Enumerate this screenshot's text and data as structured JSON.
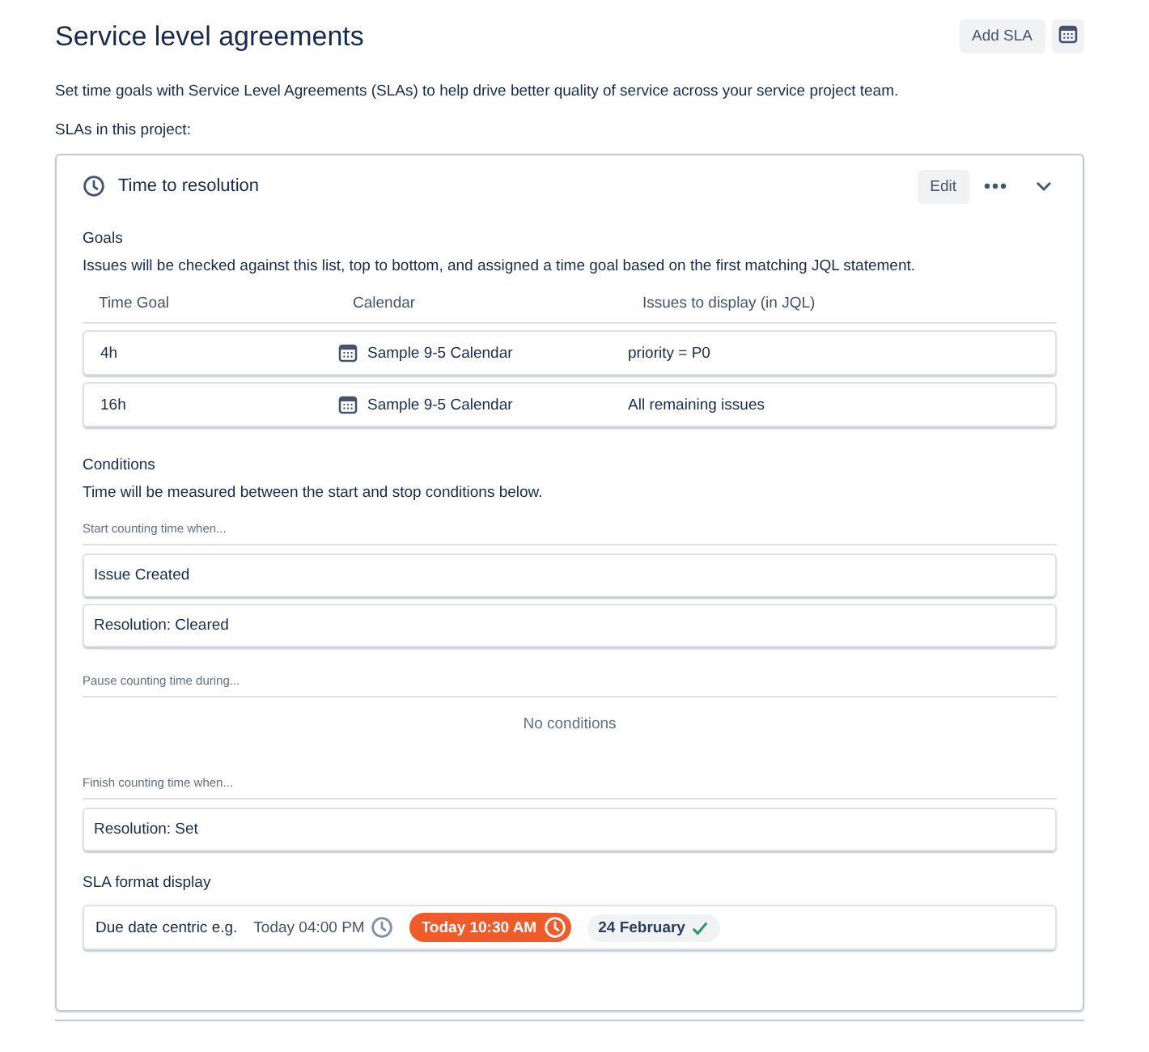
{
  "page": {
    "title": "Service level agreements",
    "description": "Set time goals with Service Level Agreements (SLAs) to help drive better quality of service across your service project team.",
    "list_label": "SLAs in this project:"
  },
  "toolbar": {
    "add_button": "Add SLA"
  },
  "sla": {
    "name": "Time to resolution",
    "edit_button": "Edit",
    "expanded": true,
    "goals": {
      "heading": "Goals",
      "description": "Issues will be checked against this list, top to bottom, and assigned a time goal based on the first matching JQL statement.",
      "columns": [
        "Time Goal",
        "Calendar",
        "Issues to display (in JQL)"
      ],
      "rows": [
        {
          "time_goal": "4h",
          "calendar": "Sample 9-5 Calendar",
          "jql": "priority = P0"
        },
        {
          "time_goal": "16h",
          "calendar": "Sample 9-5 Calendar",
          "jql": "All remaining issues"
        }
      ]
    },
    "conditions": {
      "heading": "Conditions",
      "description": "Time will be measured between the start and stop conditions below.",
      "groups": [
        {
          "label": "Start counting time when...",
          "items": [
            "Issue Created",
            "Resolution: Cleared"
          ]
        },
        {
          "label": "Pause counting time during...",
          "empty_text": "No conditions"
        },
        {
          "label": "Finish counting time when...",
          "items": [
            "Resolution: Set"
          ]
        }
      ]
    },
    "format": {
      "heading": "SLA format display",
      "label": "Due date centric e.g.",
      "examples": [
        {
          "kind": "plain",
          "text": "Today 04:00 PM"
        },
        {
          "kind": "overdue",
          "text": "Today 10:30 AM"
        },
        {
          "kind": "met",
          "text": "24 February"
        }
      ]
    }
  }
}
